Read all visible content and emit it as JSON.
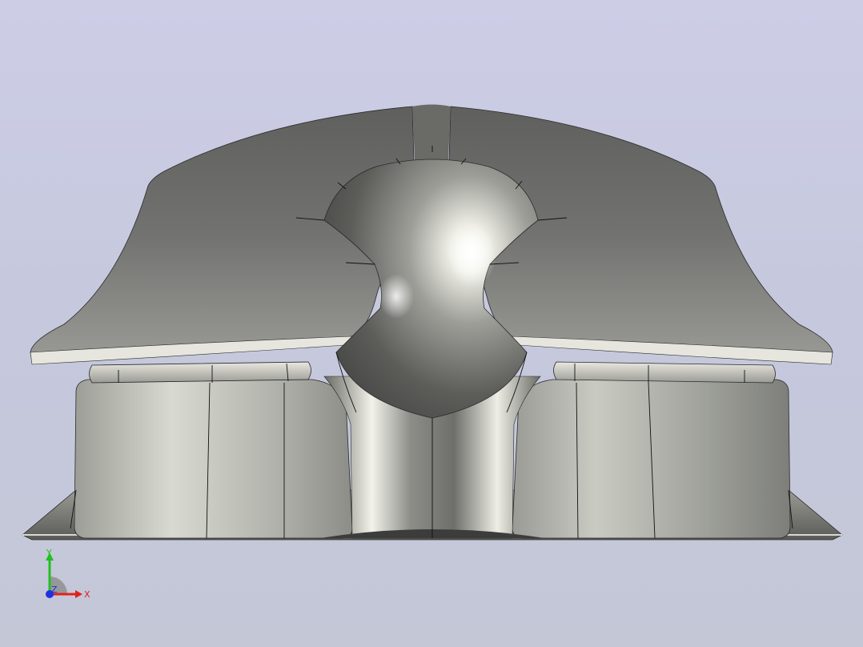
{
  "viewport": {
    "background_top": "#cdcde6",
    "background_bottom": "#c3c7d6"
  },
  "model": {
    "shading_color": "#8a8a86",
    "edge_color": "#111111"
  },
  "triad": {
    "x_label": "X",
    "y_label": "Y",
    "z_label": "Z",
    "x_color": "#e02020",
    "y_color": "#20c020",
    "z_color": "#2030e0"
  }
}
